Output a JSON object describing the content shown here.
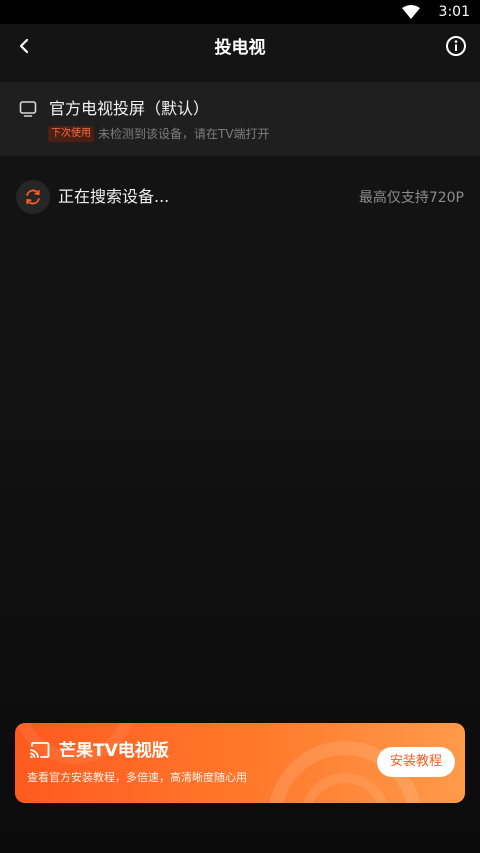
{
  "status_bar": {
    "time": "3:01",
    "wifi_icon": "wifi-icon"
  },
  "header": {
    "back_icon": "chevron-left-icon",
    "title": "投电视",
    "info_icon": "info-icon"
  },
  "default_device": {
    "icon": "tv-icon",
    "name": "官方电视投屏（默认）",
    "tag": "下次使用",
    "hint": "未检测到该设备，请在TV端打开"
  },
  "search": {
    "icon": "refresh-icon",
    "status": "正在搜索设备...",
    "resolution_note": "最高仅支持720P"
  },
  "promo": {
    "icon": "cast-icon",
    "title": "芒果TV电视版",
    "subtitle": "查看官方安装教程，多倍速，高清晰度随心用",
    "button_label": "安装教程"
  },
  "colors": {
    "accent": "#ff5a1e",
    "background": "#121212",
    "row_background": "#1f1f1f"
  }
}
